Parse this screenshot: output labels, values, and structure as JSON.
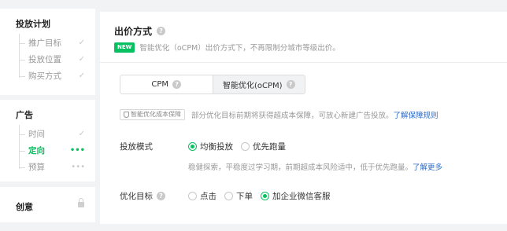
{
  "colors": {
    "accent": "#07c160",
    "link": "#2d6bc4",
    "muted": "#999999"
  },
  "sidebar": {
    "sections": [
      {
        "title": "投放计划",
        "items": [
          {
            "label": "推广目标",
            "status_icon": "check-icon",
            "status": "✓"
          },
          {
            "label": "投放位置",
            "status_icon": "check-icon",
            "status": "✓"
          },
          {
            "label": "购买方式",
            "status_icon": "check-icon",
            "status": "✓"
          }
        ]
      },
      {
        "title": "广告",
        "items": [
          {
            "label": "时间",
            "status_icon": "check-icon",
            "status": "✓"
          },
          {
            "label": "定向",
            "status_icon": "in-progress-dots-icon",
            "status": "•••",
            "active": true
          },
          {
            "label": "预算",
            "status_icon": "pending-dots-icon",
            "status": "•••"
          }
        ]
      },
      {
        "title": "创意",
        "status_icon": "lock-icon"
      }
    ]
  },
  "main": {
    "title": "出价方式",
    "title_help_icon": "help-icon",
    "new_badge": "NEW",
    "new_text": "智能优化（oCPM）出价方式下，不再限制分城市等级出价。",
    "bid_tabs": [
      {
        "label": "CPM",
        "help_icon": "help-icon",
        "selected": false
      },
      {
        "label": "智能优化(oCPM)",
        "help_icon": "help-icon",
        "selected": true
      }
    ],
    "guarantee": {
      "badge": "智能优化成本保障",
      "text": "部分优化目标前期将获得超成本保障，可放心新建广告投放。",
      "link": "了解保障规则"
    },
    "delivery_mode": {
      "label": "投放模式",
      "options": [
        {
          "label": "均衡投放",
          "checked": true
        },
        {
          "label": "优先跑量",
          "checked": false
        }
      ],
      "hint": "稳健探索，平稳度过学习期，前期超成本风险适中，低于优先跑量。",
      "hint_link": "了解更多"
    },
    "optimization_target": {
      "label": "优化目标",
      "help_icon": "help-icon",
      "options": [
        {
          "label": "点击",
          "checked": false
        },
        {
          "label": "下单",
          "checked": false
        },
        {
          "label": "加企业微信客服",
          "checked": true
        }
      ]
    }
  }
}
